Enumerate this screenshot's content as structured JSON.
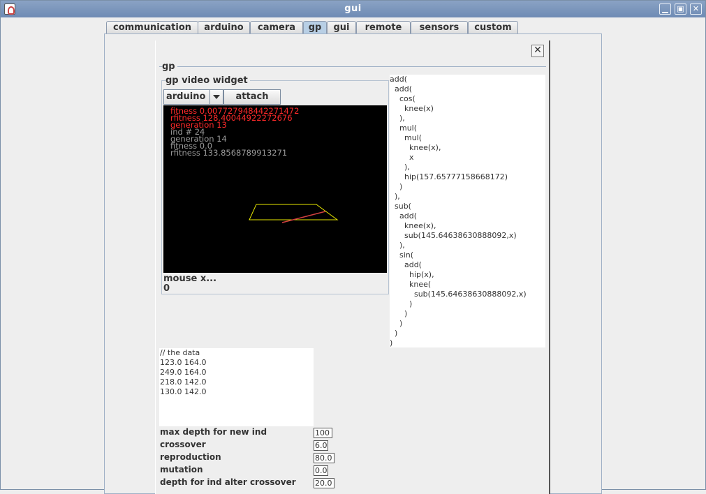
{
  "window": {
    "title": "gui"
  },
  "tabs": [
    "communication",
    "arduino",
    "camera",
    "gp",
    "gui",
    "remote",
    "sensors",
    "custom"
  ],
  "active_tab": "gp",
  "panel": {
    "section_title": "gp",
    "widget_title": "gp  video widget",
    "select_value": "arduino",
    "attach_label": "attach",
    "mouse_label": "mouse x...",
    "mouse_value": "0"
  },
  "video_overlay": {
    "lines": [
      {
        "text": "fitness    0.007727948442271472",
        "color": "#ff2a2a"
      },
      {
        "text": "rfitness   128.40044922272676",
        "color": "#ff2a2a"
      },
      {
        "text": "generation 13",
        "color": "#ff2a2a"
      },
      {
        "text": "ind #      24",
        "color": "#9a9a9a"
      },
      {
        "text": "generation 14",
        "color": "#9a9a9a"
      },
      {
        "text": "fitness 0.0",
        "color": "#9a9a9a"
      },
      {
        "text": "rfitness 133.8568789913271",
        "color": "#9a9a9a"
      }
    ],
    "shape_color": "#e6e600",
    "line_color": "#d04040"
  },
  "tree_text": "add(\n  add(\n    cos(\n      knee(x)\n    ),\n    mul(\n      mul(\n        knee(x),\n        x\n      ),\n      hip(157.65777158668172)\n    )\n  ),\n  sub(\n    add(\n      knee(x),\n      sub(145.64638630888092,x)\n    ),\n    sin(\n      add(\n        hip(x),\n        knee(\n          sub(145.64638630888092,x)\n        )\n      )\n    )\n  )\n)",
  "data_text": "// the data\n123.0 164.0\n249.0 164.0\n218.0 142.0\n130.0 142.0",
  "params": [
    {
      "label": "max depth for new ind",
      "value": "100"
    },
    {
      "label": "crossover",
      "value": "6.0"
    },
    {
      "label": "reproduction",
      "value": "80.0"
    },
    {
      "label": "mutation",
      "value": "0.0"
    },
    {
      "label": "depth for ind alter crossover",
      "value": "20.0"
    }
  ]
}
